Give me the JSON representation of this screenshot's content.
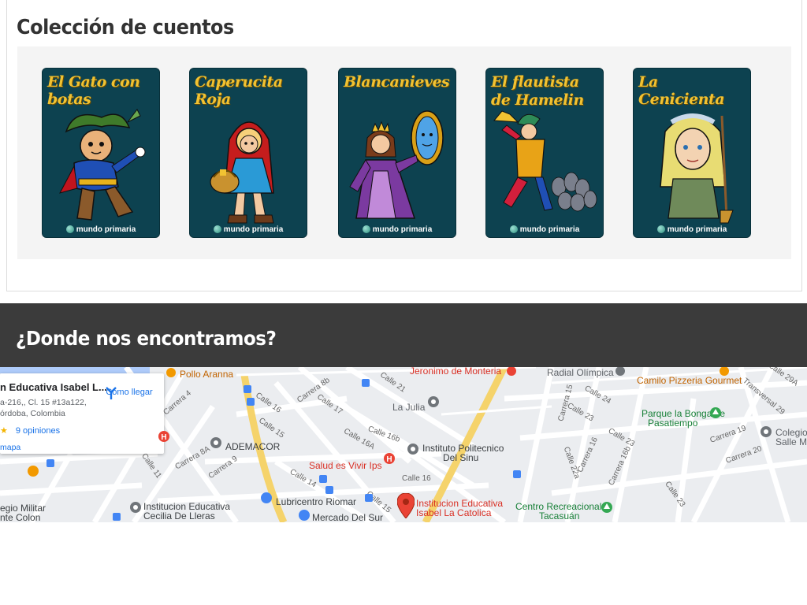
{
  "collection": {
    "title": "Colección de cuentos",
    "stories": [
      {
        "title": "El Gato con botas",
        "brand": "mundo primaria"
      },
      {
        "title": "Caperucita Roja",
        "brand": "mundo primaria"
      },
      {
        "title": "Blancanieves",
        "brand": "mundo primaria"
      },
      {
        "title": "El flautista de Hamelin",
        "brand": "mundo primaria"
      },
      {
        "title": "La Cenicienta",
        "brand": "mundo primaria"
      }
    ]
  },
  "location": {
    "title": "¿Donde nos encontramos?"
  },
  "map": {
    "info_card": {
      "name": "n Educativa Isabel L...",
      "address_line1": "a-216,, Cl. 15 #13a122,",
      "address_line2": "órdoba, Colombia",
      "reviews": "9 opiniones",
      "directions": "Cómo llegar",
      "view_map": "mapa"
    },
    "places": {
      "pollo": "Pollo Aranna",
      "jeronimo": "Jeronimo de Monteria",
      "radial": "Radial Olímpica",
      "camilo": "Camilo Pizzeria Gourmet",
      "parque1": "Parque la Bonga de",
      "parque2": "Pasatiempo",
      "colegio1": "Colegio",
      "colegio2": "Salle M",
      "lajulia": "La Julia",
      "instituto1": "Instituto Politecnico",
      "instituto2": "Del Sinu",
      "ademacor": "ADEMACOR",
      "salud": "Salud es Vivir Ips",
      "lubricentro": "Lubricentro Riomar",
      "institucion_main1": "Institucion Educativa",
      "institucion_main2": "Isabel La Catolica",
      "centro1": "Centro Recreacional",
      "centro2": "Tacasuán",
      "cecilia1": "Institucion Educativa",
      "cecilia2": "Cecilia De Lleras",
      "mercado": "Mercado Del Sur",
      "militar1": "egio Militar",
      "militar2": "nte Colon"
    },
    "streets": {
      "calle21": "Calle 21",
      "calle17": "Calle 17",
      "calle16": "Calle 16",
      "calle15": "Calle 15",
      "calle16b": "Calle 16b",
      "calle16a": "Calle 16A",
      "calle14": "Calle 14",
      "calle15b": "Calle 15",
      "calle16c": "Calle 16",
      "carrera8b": "Carrera 8b",
      "carrera4": "Carrera 4",
      "carrera8a": "Carrera 8A",
      "carrera9": "Carrera 9",
      "calle11": "Calle 11",
      "carrera15": "Carrera 15",
      "calle24": "Calle 24",
      "calle23": "Calle 23",
      "calle23b": "Calle 23",
      "calle22a": "Calle 22a",
      "carrera16": "Carrera 16",
      "carrera16b": "Carrera 16b",
      "carrera19": "Carrera 19",
      "carrera20": "Carrera 20",
      "calle23c": "Calle 23",
      "transversal29": "Transversal 29",
      "calle29a": "Calle 29A"
    }
  }
}
